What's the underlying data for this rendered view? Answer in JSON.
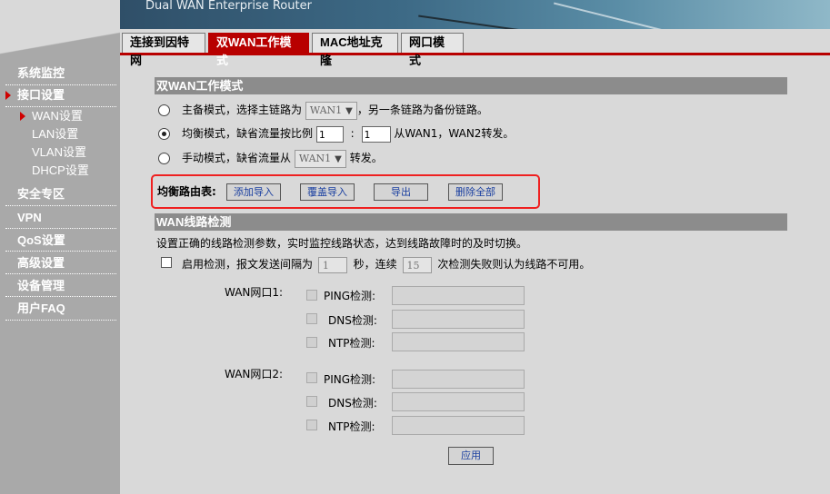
{
  "header": {
    "title": "Dual WAN Enterprise Router"
  },
  "sidebar": {
    "items": [
      {
        "label": "系统监控"
      },
      {
        "label": "接口设置"
      },
      {
        "label": "安全专区"
      },
      {
        "label": "VPN"
      },
      {
        "label": "QoS设置"
      },
      {
        "label": "高级设置"
      },
      {
        "label": "设备管理"
      },
      {
        "label": "用户FAQ"
      }
    ],
    "subitems": [
      {
        "label": "WAN设置"
      },
      {
        "label": "LAN设置"
      },
      {
        "label": "VLAN设置"
      },
      {
        "label": "DHCP设置"
      }
    ]
  },
  "tabs": [
    {
      "label": "连接到因特网"
    },
    {
      "label": "双WAN工作模式"
    },
    {
      "label": "MAC地址克隆"
    },
    {
      "label": "网口模式"
    }
  ],
  "mode": {
    "section_title": "双WAN工作模式",
    "backup_text_a": "主备模式，选择主链路为",
    "backup_select": "WAN1",
    "backup_text_b": "，另一条链路为备份链路。",
    "balance_text_a": "均衡模式，缺省流量按比例",
    "ratio_1": "1",
    "ratio_sep": ":",
    "ratio_2": "1",
    "balance_text_b": "从WAN1，WAN2转发。",
    "manual_text_a": "手动模式，缺省流量从",
    "manual_select": "WAN1",
    "manual_text_b": "转发。"
  },
  "route_table": {
    "label": "均衡路由表:",
    "add_import": "添加导入",
    "overwrite_import": "覆盖导入",
    "export": "导出",
    "delete_all": "删除全部"
  },
  "detect": {
    "section_title": "WAN线路检测",
    "description": "设置正确的线路检测参数，实时监控线路状态，达到线路故障时的及时切换。",
    "enable_text_a": "启用检测，报文发送间隔为",
    "interval": "1",
    "enable_text_b": "秒，连续",
    "fail_count": "15",
    "enable_text_c": "次检测失败则认为线路不可用。",
    "wan1_label": "WAN网口1:",
    "wan2_label": "WAN网口2:",
    "ping_label": "PING检测:",
    "dns_label": "DNS检测:",
    "ntp_label": "NTP检测:",
    "apply": "应用"
  }
}
